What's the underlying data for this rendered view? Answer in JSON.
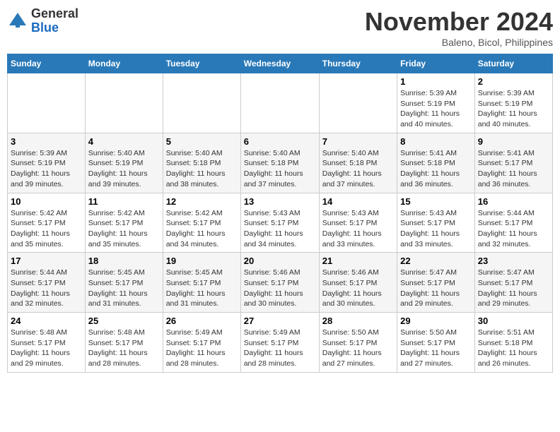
{
  "logo": {
    "general": "General",
    "blue": "Blue"
  },
  "header": {
    "month": "November 2024",
    "location": "Baleno, Bicol, Philippines"
  },
  "days_of_week": [
    "Sunday",
    "Monday",
    "Tuesday",
    "Wednesday",
    "Thursday",
    "Friday",
    "Saturday"
  ],
  "weeks": [
    [
      {
        "day": "",
        "info": ""
      },
      {
        "day": "",
        "info": ""
      },
      {
        "day": "",
        "info": ""
      },
      {
        "day": "",
        "info": ""
      },
      {
        "day": "",
        "info": ""
      },
      {
        "day": "1",
        "info": "Sunrise: 5:39 AM\nSunset: 5:19 PM\nDaylight: 11 hours and 40 minutes."
      },
      {
        "day": "2",
        "info": "Sunrise: 5:39 AM\nSunset: 5:19 PM\nDaylight: 11 hours and 40 minutes."
      }
    ],
    [
      {
        "day": "3",
        "info": "Sunrise: 5:39 AM\nSunset: 5:19 PM\nDaylight: 11 hours and 39 minutes."
      },
      {
        "day": "4",
        "info": "Sunrise: 5:40 AM\nSunset: 5:19 PM\nDaylight: 11 hours and 39 minutes."
      },
      {
        "day": "5",
        "info": "Sunrise: 5:40 AM\nSunset: 5:18 PM\nDaylight: 11 hours and 38 minutes."
      },
      {
        "day": "6",
        "info": "Sunrise: 5:40 AM\nSunset: 5:18 PM\nDaylight: 11 hours and 37 minutes."
      },
      {
        "day": "7",
        "info": "Sunrise: 5:40 AM\nSunset: 5:18 PM\nDaylight: 11 hours and 37 minutes."
      },
      {
        "day": "8",
        "info": "Sunrise: 5:41 AM\nSunset: 5:18 PM\nDaylight: 11 hours and 36 minutes."
      },
      {
        "day": "9",
        "info": "Sunrise: 5:41 AM\nSunset: 5:17 PM\nDaylight: 11 hours and 36 minutes."
      }
    ],
    [
      {
        "day": "10",
        "info": "Sunrise: 5:42 AM\nSunset: 5:17 PM\nDaylight: 11 hours and 35 minutes."
      },
      {
        "day": "11",
        "info": "Sunrise: 5:42 AM\nSunset: 5:17 PM\nDaylight: 11 hours and 35 minutes."
      },
      {
        "day": "12",
        "info": "Sunrise: 5:42 AM\nSunset: 5:17 PM\nDaylight: 11 hours and 34 minutes."
      },
      {
        "day": "13",
        "info": "Sunrise: 5:43 AM\nSunset: 5:17 PM\nDaylight: 11 hours and 34 minutes."
      },
      {
        "day": "14",
        "info": "Sunrise: 5:43 AM\nSunset: 5:17 PM\nDaylight: 11 hours and 33 minutes."
      },
      {
        "day": "15",
        "info": "Sunrise: 5:43 AM\nSunset: 5:17 PM\nDaylight: 11 hours and 33 minutes."
      },
      {
        "day": "16",
        "info": "Sunrise: 5:44 AM\nSunset: 5:17 PM\nDaylight: 11 hours and 32 minutes."
      }
    ],
    [
      {
        "day": "17",
        "info": "Sunrise: 5:44 AM\nSunset: 5:17 PM\nDaylight: 11 hours and 32 minutes."
      },
      {
        "day": "18",
        "info": "Sunrise: 5:45 AM\nSunset: 5:17 PM\nDaylight: 11 hours and 31 minutes."
      },
      {
        "day": "19",
        "info": "Sunrise: 5:45 AM\nSunset: 5:17 PM\nDaylight: 11 hours and 31 minutes."
      },
      {
        "day": "20",
        "info": "Sunrise: 5:46 AM\nSunset: 5:17 PM\nDaylight: 11 hours and 30 minutes."
      },
      {
        "day": "21",
        "info": "Sunrise: 5:46 AM\nSunset: 5:17 PM\nDaylight: 11 hours and 30 minutes."
      },
      {
        "day": "22",
        "info": "Sunrise: 5:47 AM\nSunset: 5:17 PM\nDaylight: 11 hours and 29 minutes."
      },
      {
        "day": "23",
        "info": "Sunrise: 5:47 AM\nSunset: 5:17 PM\nDaylight: 11 hours and 29 minutes."
      }
    ],
    [
      {
        "day": "24",
        "info": "Sunrise: 5:48 AM\nSunset: 5:17 PM\nDaylight: 11 hours and 29 minutes."
      },
      {
        "day": "25",
        "info": "Sunrise: 5:48 AM\nSunset: 5:17 PM\nDaylight: 11 hours and 28 minutes."
      },
      {
        "day": "26",
        "info": "Sunrise: 5:49 AM\nSunset: 5:17 PM\nDaylight: 11 hours and 28 minutes."
      },
      {
        "day": "27",
        "info": "Sunrise: 5:49 AM\nSunset: 5:17 PM\nDaylight: 11 hours and 28 minutes."
      },
      {
        "day": "28",
        "info": "Sunrise: 5:50 AM\nSunset: 5:17 PM\nDaylight: 11 hours and 27 minutes."
      },
      {
        "day": "29",
        "info": "Sunrise: 5:50 AM\nSunset: 5:17 PM\nDaylight: 11 hours and 27 minutes."
      },
      {
        "day": "30",
        "info": "Sunrise: 5:51 AM\nSunset: 5:18 PM\nDaylight: 11 hours and 26 minutes."
      }
    ]
  ]
}
